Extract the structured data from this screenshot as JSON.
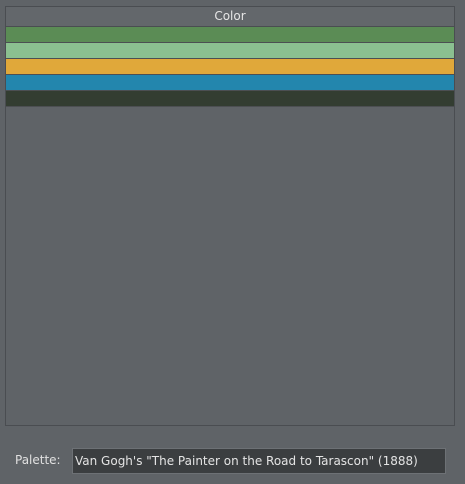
{
  "color_list": {
    "header": "Color",
    "swatches": [
      {
        "color": "#5b8c55"
      },
      {
        "color": "#8bc090"
      },
      {
        "color": "#e0a83a"
      },
      {
        "color": "#2386ad"
      },
      {
        "color": "#333d31"
      }
    ]
  },
  "palette": {
    "label": "Palette:",
    "value": "Van Gogh's \"The Painter on the Road to Tarascon\" (1888)"
  }
}
